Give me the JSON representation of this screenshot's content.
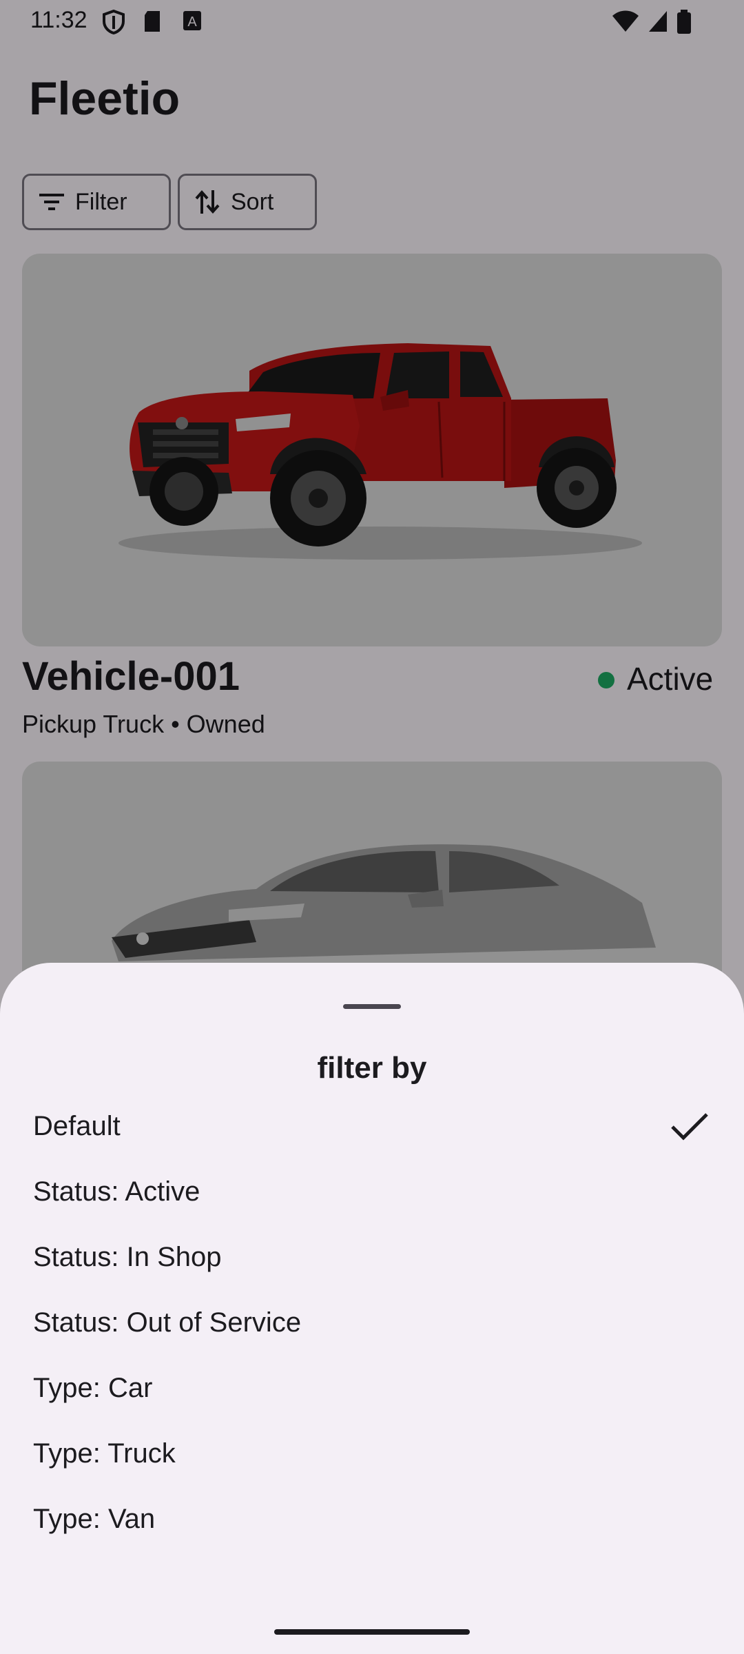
{
  "status_bar": {
    "time": "11:32",
    "icons": [
      "shield-icon",
      "sd-card-icon",
      "font-a-icon",
      "wifi-icon",
      "signal-icon",
      "battery-icon"
    ]
  },
  "app": {
    "title": "Fleetio"
  },
  "toolbar": {
    "filter_label": "Filter",
    "sort_label": "Sort"
  },
  "vehicles": [
    {
      "name": "Vehicle-001",
      "subtitle": "Pickup Truck • Owned",
      "status": "Active",
      "status_color": "#1eaa63",
      "body_color": "#b81414"
    },
    {
      "body_color": "#9a9a9a"
    }
  ],
  "filter_sheet": {
    "title": "filter by",
    "options": [
      {
        "label": "Default",
        "selected": true
      },
      {
        "label": "Status: Active",
        "selected": false
      },
      {
        "label": "Status: In Shop",
        "selected": false
      },
      {
        "label": "Status: Out of Service",
        "selected": false
      },
      {
        "label": "Type: Car",
        "selected": false
      },
      {
        "label": "Type: Truck",
        "selected": false
      },
      {
        "label": "Type: Van",
        "selected": false
      }
    ]
  },
  "colors": {
    "sheet_bg": "#f4eff6",
    "scrim": "rgba(0,0,0,0.34)",
    "active_dot": "#1eaa63"
  }
}
